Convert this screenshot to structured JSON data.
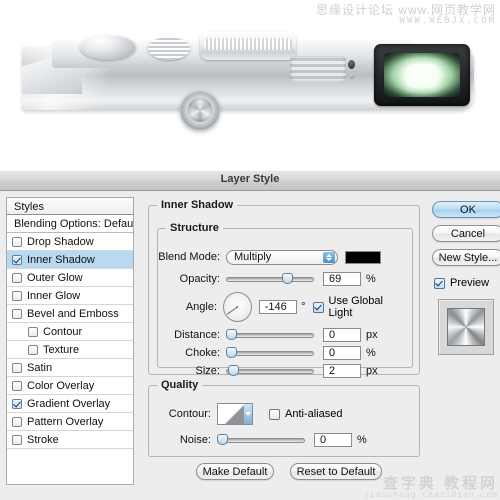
{
  "watermarks": {
    "top_line1": "思缘设计论坛 www.网页教学网",
    "top_line2": "WWW.WEBJX.COM",
    "bottom_line1": "查字典 教程网",
    "bottom_line2": "jiaocheng.chazidian.com"
  },
  "photo": {
    "subject": "camera-body-top-view",
    "alt": "Brushed metal camera top with dials, shutter button and viewfinder"
  },
  "dialog": {
    "title": "Layer Style"
  },
  "styles": {
    "header": "Styles",
    "blending_options": "Blending Options: Default",
    "items": [
      {
        "label": "Drop Shadow",
        "checked": false,
        "selected": false,
        "indent": false
      },
      {
        "label": "Inner Shadow",
        "checked": true,
        "selected": true,
        "indent": false
      },
      {
        "label": "Outer Glow",
        "checked": false,
        "selected": false,
        "indent": false
      },
      {
        "label": "Inner Glow",
        "checked": false,
        "selected": false,
        "indent": false
      },
      {
        "label": "Bevel and Emboss",
        "checked": false,
        "selected": false,
        "indent": false
      },
      {
        "label": "Contour",
        "checked": false,
        "selected": false,
        "indent": true
      },
      {
        "label": "Texture",
        "checked": false,
        "selected": false,
        "indent": true
      },
      {
        "label": "Satin",
        "checked": false,
        "selected": false,
        "indent": false
      },
      {
        "label": "Color Overlay",
        "checked": false,
        "selected": false,
        "indent": false
      },
      {
        "label": "Gradient Overlay",
        "checked": true,
        "selected": false,
        "indent": false
      },
      {
        "label": "Pattern Overlay",
        "checked": false,
        "selected": false,
        "indent": false
      },
      {
        "label": "Stroke",
        "checked": false,
        "selected": false,
        "indent": false
      }
    ]
  },
  "effect": {
    "title": "Inner Shadow",
    "structure": {
      "title": "Structure",
      "blend_mode_label": "Blend Mode:",
      "blend_mode_value": "Multiply",
      "blend_color": "#000000",
      "opacity_label": "Opacity:",
      "opacity_value": "69",
      "opacity_unit": "%",
      "angle_label": "Angle:",
      "angle_value": "-146",
      "angle_unit": "°",
      "use_global_light": "Use Global Light",
      "use_global_light_checked": true,
      "distance_label": "Distance:",
      "distance_value": "0",
      "distance_unit": "px",
      "choke_label": "Choke:",
      "choke_value": "0",
      "choke_unit": "%",
      "size_label": "Size:",
      "size_value": "2",
      "size_unit": "px"
    },
    "quality": {
      "title": "Quality",
      "contour_label": "Contour:",
      "anti_aliased": "Anti-aliased",
      "anti_aliased_checked": false,
      "noise_label": "Noise:",
      "noise_value": "0",
      "noise_unit": "%"
    }
  },
  "actions": {
    "make_default": "Make Default",
    "reset_to_default": "Reset to Default",
    "ok": "OK",
    "cancel": "Cancel",
    "new_style": "New Style...",
    "preview": "Preview",
    "preview_checked": true
  }
}
